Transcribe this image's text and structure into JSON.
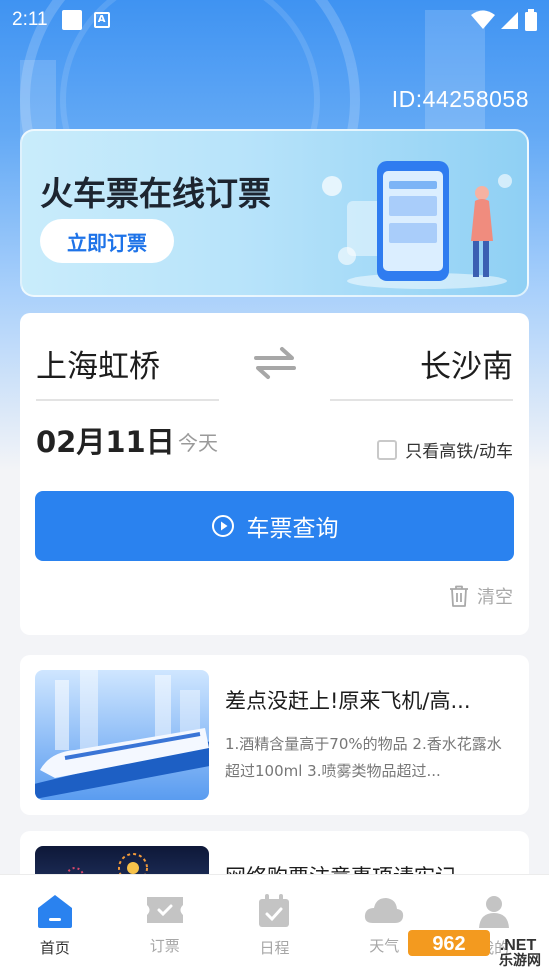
{
  "status_bar": {
    "time": "2:11"
  },
  "account": {
    "id_label": "ID:44258058"
  },
  "banner": {
    "title": "火车票在线订票",
    "button_label": "立即订票"
  },
  "search": {
    "from_station": "上海虹桥",
    "to_station": "长沙南",
    "date": "02月11日",
    "date_hint": "今天",
    "high_speed_only_label": "只看高铁/动车",
    "high_speed_only_checked": false,
    "query_button_label": "车票查询",
    "clear_label": "清空"
  },
  "news": [
    {
      "title": "差点没赶上!原来飞机/高...",
      "desc": "1.酒精含量高于70%的物品 2.香水花露水超过100ml 3.喷雾类物品超过..."
    },
    {
      "title": "网络购票注意事项请牢记"
    }
  ],
  "tabs": [
    {
      "label": "首页",
      "icon": "home-icon",
      "active": true
    },
    {
      "label": "订票",
      "icon": "ticket-icon",
      "active": false
    },
    {
      "label": "日程",
      "icon": "calendar-icon",
      "active": false
    },
    {
      "label": "天气",
      "icon": "cloud-icon",
      "active": false
    },
    {
      "label": "我的",
      "icon": "user-icon",
      "active": false
    }
  ],
  "watermark": {
    "text": "乐游网",
    "logo": "962.NET"
  },
  "colors": {
    "primary": "#2a82ef",
    "tab_active": "#2a82ef",
    "tab_inactive": "#a7a7a7"
  }
}
